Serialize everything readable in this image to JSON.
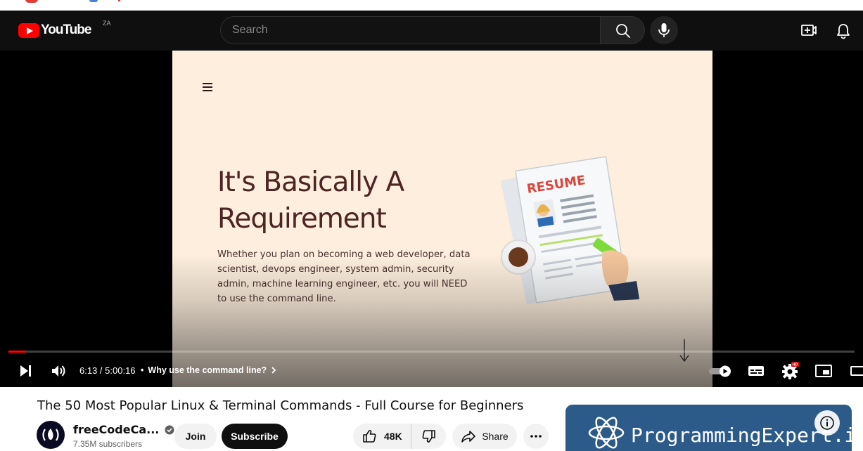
{
  "masthead": {
    "logo_text": "YouTube",
    "country_code": "ZA",
    "search_placeholder": "Search"
  },
  "slide": {
    "title_line1": "It's Basically A",
    "title_line2": "Requirement",
    "body": "Whether you plan on becoming a web developer, data scientist, devops engineer, system admin,  security admin, machine learning engineer, etc. you will NEED to use the command line.",
    "art_label": "RESUME"
  },
  "player": {
    "time_current": "6:13",
    "time_sep": " / ",
    "time_total": "5:00:16",
    "chapter_sep": "•",
    "chapter_title": "Why use the command line?",
    "progress_fraction": 0.0207,
    "hd_badge": "HD"
  },
  "video": {
    "title": "The 50 Most Popular Linux & Terminal Commands - Full Course for Beginners",
    "channel_name": "freeCodeCa...",
    "subscribers": "7.35M subscribers",
    "join_label": "Join",
    "subscribe_label": "Subscribe",
    "like_count": "48K",
    "share_label": "Share"
  },
  "ad": {
    "text": "ProgrammingExpert.io"
  },
  "colors": {
    "brand_red": "#ff0000",
    "masthead_bg": "#0f0f0f",
    "slide_bg": "#fdeedd",
    "slide_title": "#4e2424",
    "ad_bg": "#2c5b8a"
  },
  "icons": [
    "youtube-logo-icon",
    "search-icon",
    "mic-icon",
    "create-icon",
    "bell-icon",
    "menu-icon",
    "next-icon",
    "volume-icon",
    "chevron-right-icon",
    "autoplay-toggle-icon",
    "captions-icon",
    "settings-icon",
    "miniplayer-icon",
    "theater-icon",
    "verified-icon",
    "like-icon",
    "dislike-icon",
    "share-icon",
    "more-icon",
    "info-icon",
    "atom-icon",
    "down-arrow-icon"
  ]
}
